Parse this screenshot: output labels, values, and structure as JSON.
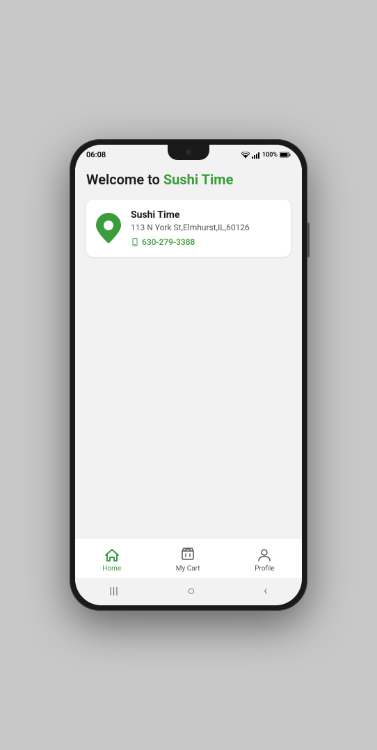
{
  "statusBar": {
    "time": "06:08",
    "battery": "100%",
    "batteryIcon": "🔋",
    "signalIcons": "📶"
  },
  "header": {
    "welcomeText": "Welcome to ",
    "brandName": "Sushi Time"
  },
  "locationCard": {
    "restaurantName": "Sushi Time",
    "address": "113 N York St,Elmhurst,IL,60126",
    "phone": "630-279-3388"
  },
  "bottomNav": {
    "items": [
      {
        "id": "home",
        "label": "Home",
        "active": true
      },
      {
        "id": "cart",
        "label": "My Cart",
        "active": false
      },
      {
        "id": "profile",
        "label": "Profile",
        "active": false
      }
    ]
  },
  "androidNav": {
    "back": "‹",
    "home": "○",
    "recents": "|||"
  }
}
